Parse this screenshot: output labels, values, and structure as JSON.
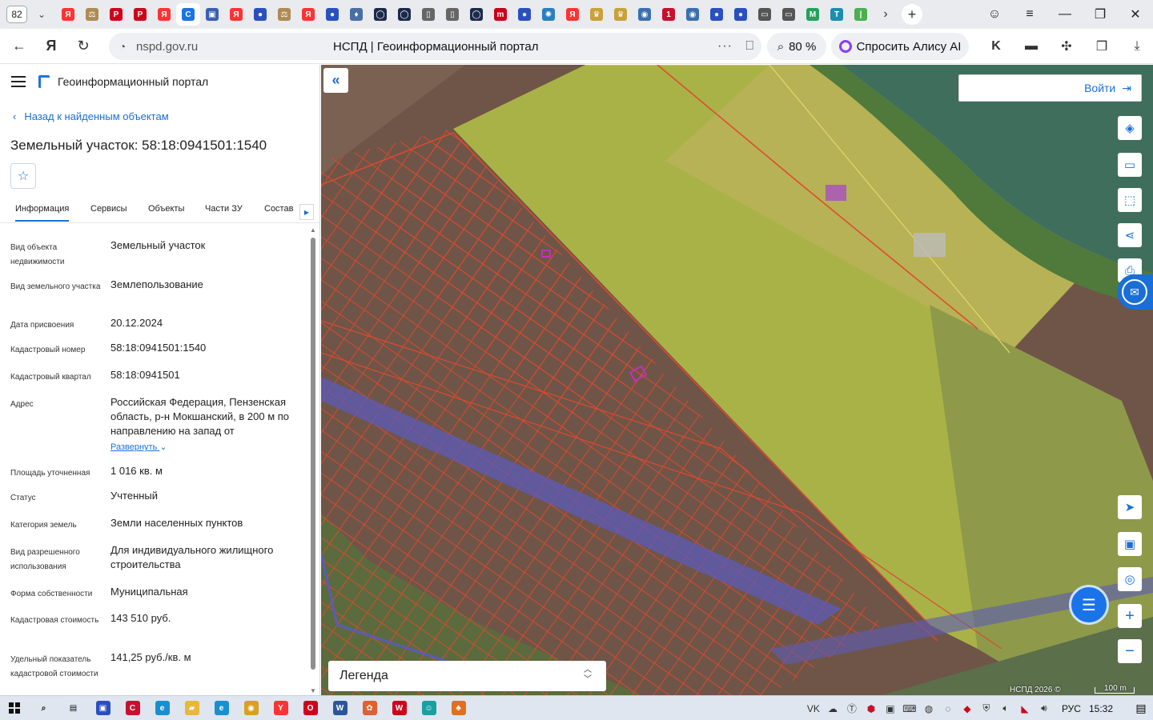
{
  "browser": {
    "tab_count": "82",
    "url": "nspd.gov.ru",
    "page_title": "НСПД | Геоинформационный портал",
    "zoom": "80 %",
    "alice_label": "Спросить Алису AI",
    "tab_favicons": [
      {
        "icon": "yandex-icon",
        "color": "#ff3333",
        "glyph": "Я"
      },
      {
        "icon": "scales-icon",
        "color": "#b08a55",
        "glyph": "⚖"
      },
      {
        "icon": "pdf-icon",
        "color": "#d0021b",
        "glyph": "P"
      },
      {
        "icon": "pdf-icon",
        "color": "#d0021b",
        "glyph": "P"
      },
      {
        "icon": "yandex-icon",
        "color": "#ff3333",
        "glyph": "Я"
      },
      {
        "icon": "nspd-icon",
        "color": "#1a73e8",
        "glyph": "C"
      },
      {
        "icon": "emblem-icon",
        "color": "#3a5fb0",
        "glyph": "▣"
      },
      {
        "icon": "yandex-icon",
        "color": "#ff3333",
        "glyph": "Я"
      },
      {
        "icon": "russia-flag-icon",
        "color": "#2a4fbf",
        "glyph": "●"
      },
      {
        "icon": "scales-icon",
        "color": "#b08a55",
        "glyph": "⚖"
      },
      {
        "icon": "yandex-icon",
        "color": "#ff3333",
        "glyph": "Я"
      },
      {
        "icon": "russia-flag-icon",
        "color": "#2a4fbf",
        "glyph": "●"
      },
      {
        "icon": "rosreestr-icon",
        "color": "#4a6fa5",
        "glyph": "♦"
      },
      {
        "icon": "ring-icon",
        "color": "#1b2a4a",
        "glyph": "◯"
      },
      {
        "icon": "ring-icon",
        "color": "#1b2a4a",
        "glyph": "◯"
      },
      {
        "icon": "document-icon",
        "color": "#666666",
        "glyph": "▯"
      },
      {
        "icon": "document-icon",
        "color": "#666666",
        "glyph": "▯"
      },
      {
        "icon": "ring-icon",
        "color": "#1b2a4a",
        "glyph": "◯"
      },
      {
        "icon": "mp-icon",
        "color": "#c8001a",
        "glyph": "m"
      },
      {
        "icon": "russia-flag-icon",
        "color": "#2a4fbf",
        "glyph": "●"
      },
      {
        "icon": "globe-icon",
        "color": "#2a7fbf",
        "glyph": "✺"
      },
      {
        "icon": "yandex-icon",
        "color": "#ff3333",
        "glyph": "Я"
      },
      {
        "icon": "coat-of-arms-icon",
        "color": "#c8a13a",
        "glyph": "♛"
      },
      {
        "icon": "coat-of-arms-icon",
        "color": "#c8a13a",
        "glyph": "♛"
      },
      {
        "icon": "fns-icon",
        "color": "#3a6fb0",
        "glyph": "◉"
      },
      {
        "icon": "gosuslugi-icon",
        "color": "#c8102e",
        "glyph": "1"
      },
      {
        "icon": "fns-icon",
        "color": "#3a6fb0",
        "glyph": "◉"
      },
      {
        "icon": "russia-flag-icon",
        "color": "#2a4fbf",
        "glyph": "●"
      },
      {
        "icon": "russia-flag-icon",
        "color": "#2a4fbf",
        "glyph": "●"
      },
      {
        "icon": "site-icon",
        "color": "#555555",
        "glyph": "▭"
      },
      {
        "icon": "site-icon",
        "color": "#555555",
        "glyph": "▭"
      },
      {
        "icon": "mail-icon",
        "color": "#22a35a",
        "glyph": "M"
      },
      {
        "icon": "tk-icon",
        "color": "#1a8fb0",
        "glyph": "T"
      },
      {
        "icon": "green-icon",
        "color": "#4caf50",
        "glyph": "|"
      }
    ]
  },
  "sidebar": {
    "portal_title": "Геоинформационный портал",
    "back_link": "Назад к найденным объектам",
    "object_title": "Земельный участок: 58:18:0941501:1540",
    "tabs": [
      "Информация",
      "Сервисы",
      "Объекты",
      "Части ЗУ",
      "Состав"
    ],
    "properties": [
      {
        "label": "Вид объекта недвижимости",
        "value": "Земельный участок"
      },
      {
        "label": "Вид земельного участка",
        "value": "Землепользование"
      },
      {
        "label": "Дата присвоения",
        "value": "20.12.2024"
      },
      {
        "label": "Кадастровый номер",
        "value": "58:18:0941501:1540"
      },
      {
        "label": "Кадастровый квартал",
        "value": "58:18:0941501"
      },
      {
        "label": "Адрес",
        "value": "Российская Федерация, Пензенская область, р-н Мокшанский, в 200 м по направлению на запад от",
        "expand": "Развернуть"
      },
      {
        "label": "Площадь уточненная",
        "value": "1 016 кв. м"
      },
      {
        "label": "Статус",
        "value": "Учтенный"
      },
      {
        "label": "Категория земель",
        "value": "Земли населенных пунктов"
      },
      {
        "label": "Вид разрешенного использования",
        "value": "Для индивидуального жилищного строительства"
      },
      {
        "label": "Форма собственности",
        "value": "Муниципальная"
      },
      {
        "label": "Кадастровая стоимость",
        "value": "143 510 руб."
      },
      {
        "label": "Удельный показатель кадастровой стоимости",
        "value": "141,25 руб./кв. м"
      }
    ]
  },
  "map": {
    "login_label": "Войти",
    "legend_label": "Легенда",
    "attribution": "НСПД 2026 ©",
    "scale_label": "100 m",
    "colors": {
      "parcel_border": "#e0482e",
      "field_green": "#a9b247",
      "plowed_field": "#6b5244",
      "river": "#3f6e5d",
      "power_line_zone": "#5b5bb8",
      "accent": "#1a73e8"
    }
  },
  "taskbar": {
    "language": "РУС",
    "time": "15:32",
    "apps": [
      {
        "icon": "search-icon",
        "color": "#111111",
        "glyph": "⌕"
      },
      {
        "icon": "task-view-icon",
        "color": "#111111",
        "glyph": "▤"
      },
      {
        "icon": "save-disk-icon",
        "color": "#2a4fbf",
        "glyph": "▣"
      },
      {
        "icon": "c-app-icon",
        "color": "#c8102e",
        "glyph": "C"
      },
      {
        "icon": "edge-icon",
        "color": "#1a8fd0",
        "glyph": "e"
      },
      {
        "icon": "folder-icon",
        "color": "#e8b83a",
        "glyph": "▰"
      },
      {
        "icon": "ie-icon",
        "color": "#1a8fd0",
        "glyph": "e"
      },
      {
        "icon": "chrome-icon",
        "color": "#d9a021",
        "glyph": "◉"
      },
      {
        "icon": "yandex-browser-icon",
        "color": "#ff3333",
        "glyph": "Y"
      },
      {
        "icon": "opera-icon",
        "color": "#d0021b",
        "glyph": "O"
      },
      {
        "icon": "word-icon",
        "color": "#2b579a",
        "glyph": "W"
      },
      {
        "icon": "app-icon",
        "color": "#e06030",
        "glyph": "✿"
      },
      {
        "icon": "wps-icon",
        "color": "#d0021b",
        "glyph": "W"
      },
      {
        "icon": "app-icon",
        "color": "#1aa0a0",
        "glyph": "☺"
      },
      {
        "icon": "app-icon",
        "color": "#e07020",
        "glyph": "♣"
      }
    ]
  }
}
